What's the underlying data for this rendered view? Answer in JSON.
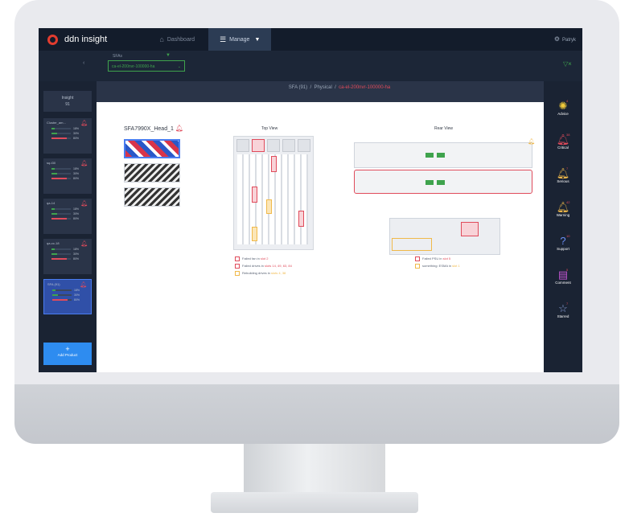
{
  "app": {
    "brand": "ddn insight",
    "user": "Patryk"
  },
  "topnav": {
    "dashboard": "Dashboard",
    "manage": "Manage"
  },
  "filter": {
    "label": "SFAs",
    "selected": "ca-el-200nvr-100000-ha"
  },
  "breadcrumb": {
    "sfa": "SFA (91)",
    "sep": "/",
    "physical": "Physical",
    "current": "ca-el-200nvr-100000-ha"
  },
  "leftnav": {
    "insight": {
      "title": "Insight",
      "count": "91"
    },
    "products": [
      {
        "name": "Cluster_am...",
        "bars": [
          {
            "pct": "18%",
            "fill": 0.18,
            "color": "#3fa34d"
          },
          {
            "pct": "30%",
            "fill": 0.3,
            "color": "#3fa34d"
          },
          {
            "pct": "80%",
            "fill": 0.8,
            "color": "#e04b5b"
          }
        ]
      },
      {
        "name": "sq-t30",
        "bars": [
          {
            "pct": "18%",
            "fill": 0.18,
            "color": "#3fa34d"
          },
          {
            "pct": "30%",
            "fill": 0.3,
            "color": "#3fa34d"
          },
          {
            "pct": "80%",
            "fill": 0.8,
            "color": "#e04b5b"
          }
        ]
      },
      {
        "name": "qa-14",
        "bars": [
          {
            "pct": "18%",
            "fill": 0.18,
            "color": "#3fa34d"
          },
          {
            "pct": "30%",
            "fill": 0.3,
            "color": "#3fa34d"
          },
          {
            "pct": "80%",
            "fill": 0.8,
            "color": "#e04b5b"
          }
        ]
      },
      {
        "name": "qa-cc-18",
        "bars": [
          {
            "pct": "18%",
            "fill": 0.18,
            "color": "#3fa34d"
          },
          {
            "pct": "30%",
            "fill": 0.3,
            "color": "#3fa34d"
          },
          {
            "pct": "80%",
            "fill": 0.8,
            "color": "#e04b5b"
          }
        ]
      },
      {
        "name": "SFA (91)",
        "bars": [
          {
            "pct": "18%",
            "fill": 0.18,
            "color": "#3fa34d"
          },
          {
            "pct": "30%",
            "fill": 0.3,
            "color": "#3fa34d"
          },
          {
            "pct": "80%",
            "fill": 0.8,
            "color": "#e04b5b"
          }
        ]
      }
    ],
    "add_product": "Add Product"
  },
  "rightnav": [
    {
      "label": "Advice",
      "icon": "bulb-icon",
      "count": "4"
    },
    {
      "label": "Critical",
      "icon": "bell-icon",
      "count": "38"
    },
    {
      "label": "Serious",
      "icon": "bell-icon",
      "count": "7"
    },
    {
      "label": "Warning",
      "icon": "bell-icon",
      "count": "42"
    },
    {
      "label": "Support",
      "icon": "help-icon",
      "count": "10"
    },
    {
      "label": "Comment",
      "icon": "comment-icon",
      "count": "5"
    },
    {
      "label": "Starred",
      "icon": "star-icon",
      "count": "7"
    }
  ],
  "main": {
    "head_name": "SFA7990X_Head_1",
    "top_view": "Top View",
    "rear_view": "Rear View",
    "legend_top": [
      {
        "prefix": "Failed fan in ",
        "hl": "slot 2",
        "color": "red"
      },
      {
        "prefix": "Failed drives in ",
        "hl": "slots 14, 49, 63, 84",
        "color": "red"
      },
      {
        "prefix": "Rebuilding drives in ",
        "hl": "slots 4, 38",
        "color": "yellow"
      }
    ],
    "legend_rear": [
      {
        "prefix": "Failed PSU in ",
        "hl": "slot 5",
        "color": "red"
      },
      {
        "prefix": "something: ESMA in ",
        "hl": "slot 1",
        "color": "yellow"
      }
    ]
  }
}
